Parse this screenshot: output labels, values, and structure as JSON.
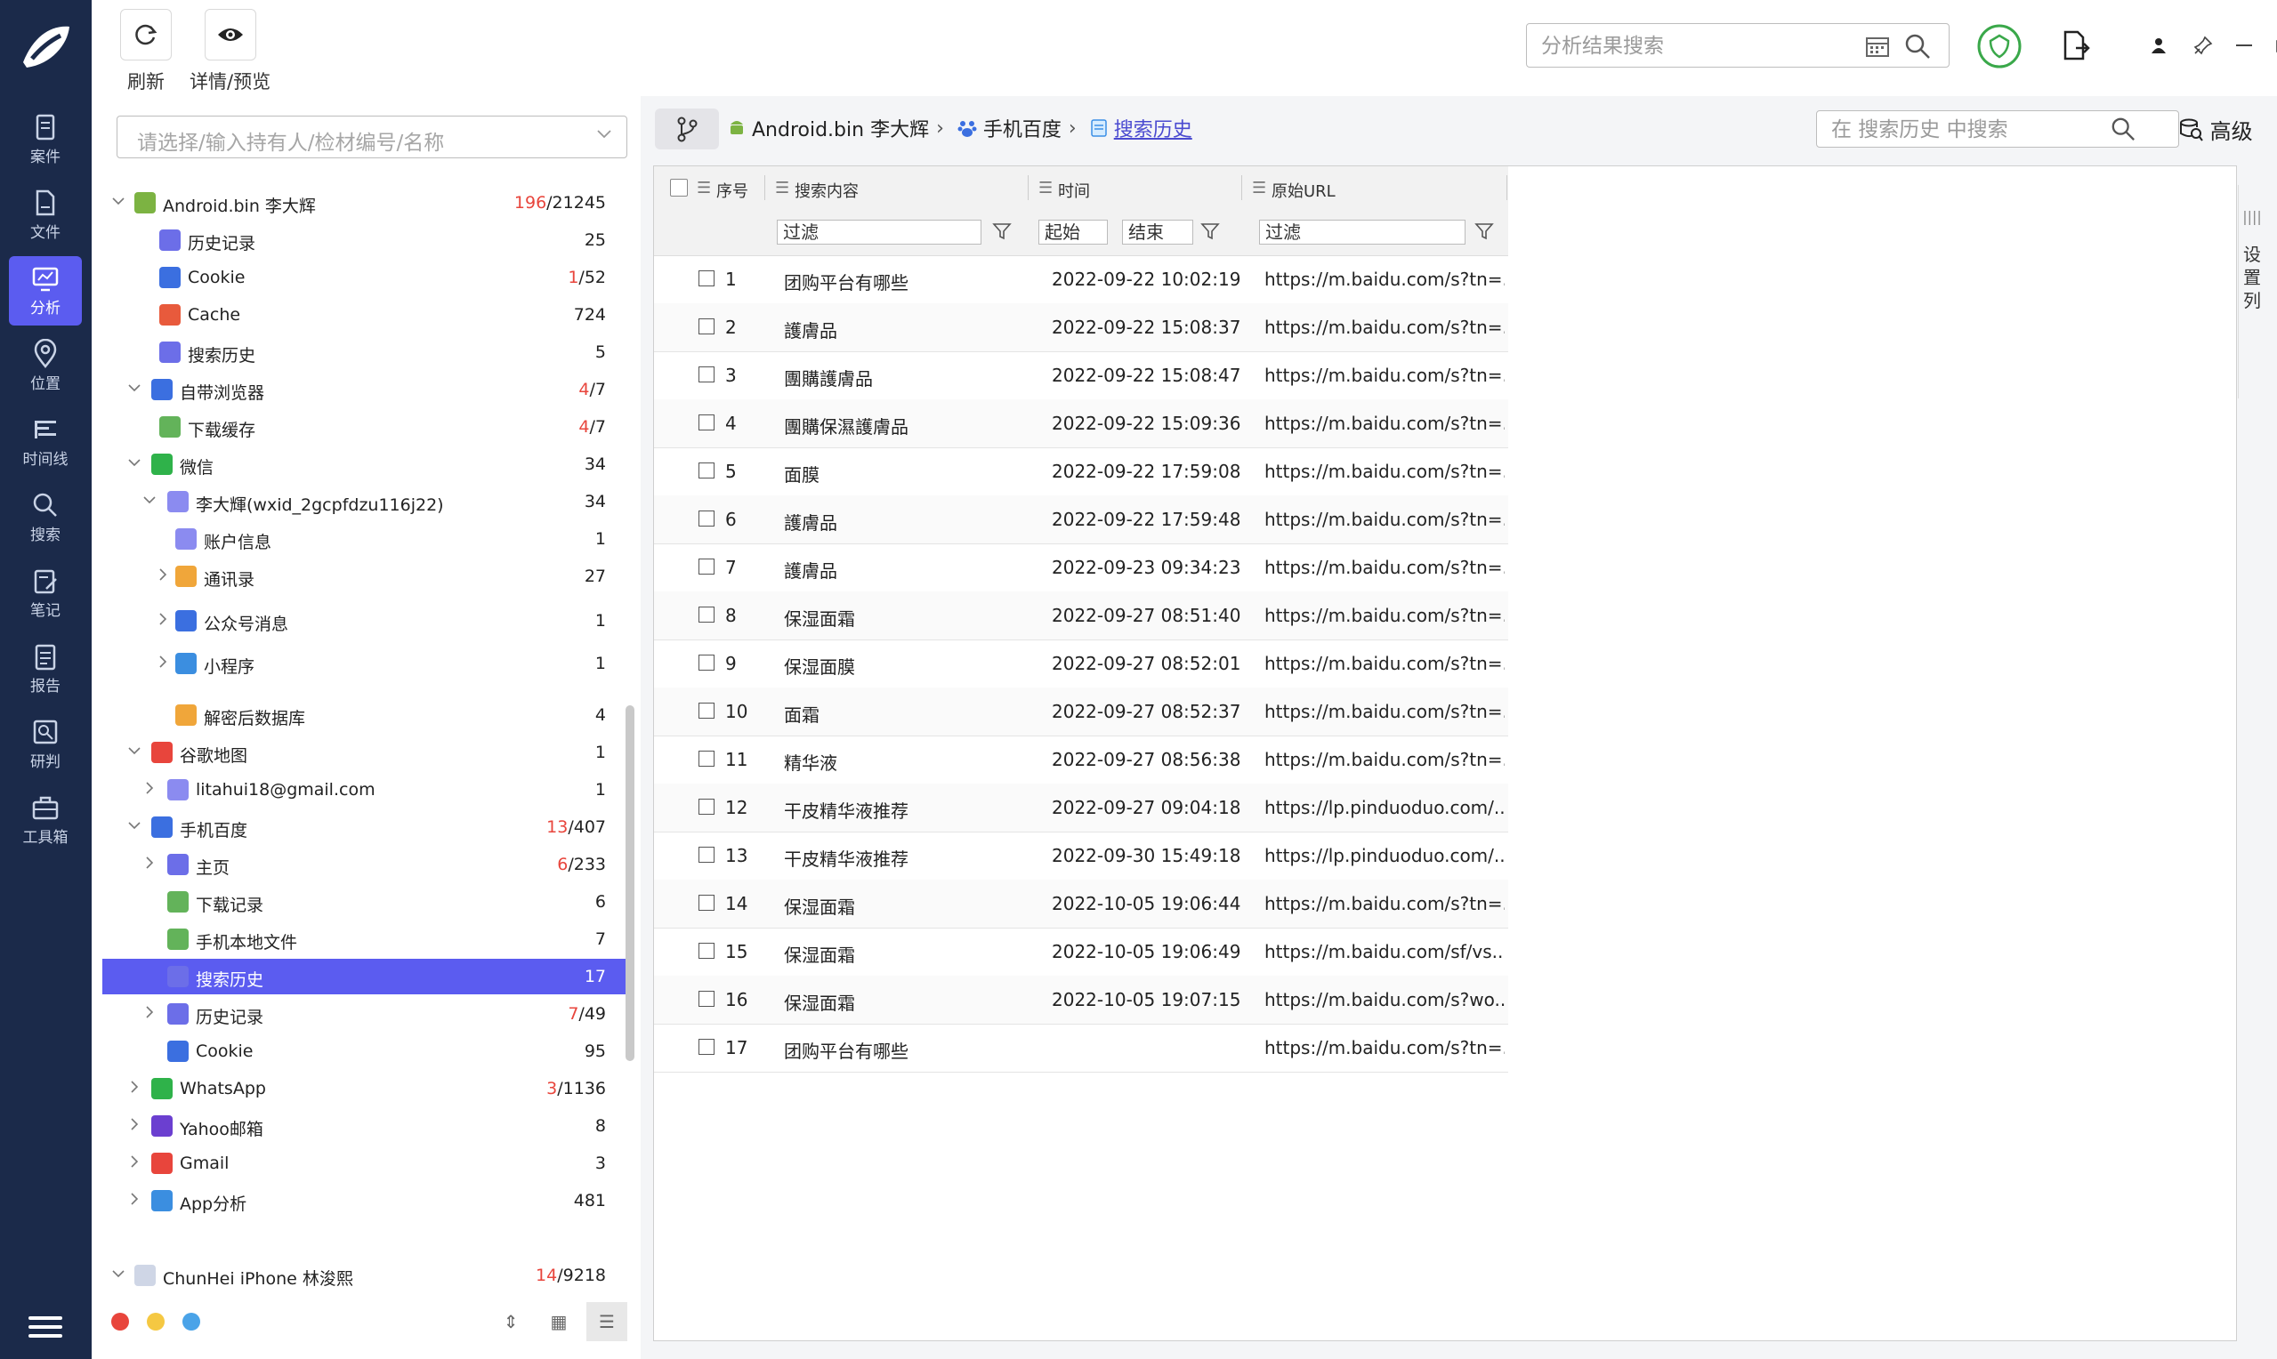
{
  "rail": {
    "items": [
      {
        "label": "案件",
        "icon": "case-icon"
      },
      {
        "label": "文件",
        "icon": "file-icon"
      },
      {
        "label": "分析",
        "icon": "analysis-icon"
      },
      {
        "label": "位置",
        "icon": "location-icon"
      },
      {
        "label": "时间线",
        "icon": "timeline-icon"
      },
      {
        "label": "搜索",
        "icon": "search-icon"
      },
      {
        "label": "笔记",
        "icon": "note-icon"
      },
      {
        "label": "报告",
        "icon": "report-icon"
      },
      {
        "label": "研判",
        "icon": "judge-icon"
      },
      {
        "label": "工具箱",
        "icon": "toolbox-icon"
      }
    ],
    "active_index": 2,
    "accent": "#5b5cf0",
    "bg": "#1b2a4a"
  },
  "toolbar": {
    "refresh_label": "刷新",
    "preview_label": "详情/预览",
    "search_placeholder": "分析结果搜索"
  },
  "tree": {
    "filter_placeholder": "请选择/输入持有人/检材编号/名称",
    "rows": [
      {
        "label": "Android.bin 李大辉",
        "count_red": "196",
        "count": "/21245",
        "icon": "android-icon"
      },
      {
        "label": "历史记录",
        "count_red": "",
        "count": "25",
        "icon": "history-icon"
      },
      {
        "label": "Cookie",
        "count_red": "1",
        "count": "/52",
        "icon": "cookie-icon"
      },
      {
        "label": "Cache",
        "count_red": "",
        "count": "724",
        "icon": "cache-icon"
      },
      {
        "label": "搜索历史",
        "count_red": "",
        "count": "5",
        "icon": "search-history-icon"
      },
      {
        "label": "自带浏览器",
        "count_red": "4",
        "count": "/7",
        "icon": "browser-icon"
      },
      {
        "label": "下载缓存",
        "count_red": "4",
        "count": "/7",
        "icon": "download-icon"
      },
      {
        "label": "微信",
        "count_red": "",
        "count": "34",
        "icon": "wechat-icon"
      },
      {
        "label": "李大輝(wxid_2gcpfdzu116j22)",
        "count_red": "",
        "count": "34",
        "icon": "user-icon"
      },
      {
        "label": "账户信息",
        "count_red": "",
        "count": "1",
        "icon": "account-icon"
      },
      {
        "label": "通讯录",
        "count_red": "",
        "count": "27",
        "icon": "contacts-icon"
      },
      {
        "label": "公众号消息",
        "count_red": "",
        "count": "1",
        "icon": "official-account-icon"
      },
      {
        "label": "小程序",
        "count_red": "",
        "count": "1",
        "icon": "mini-program-icon"
      },
      {
        "label": "解密后数据库",
        "count_red": "",
        "count": "4",
        "icon": "database-icon"
      },
      {
        "label": "谷歌地图",
        "count_red": "",
        "count": "1",
        "icon": "google-maps-icon"
      },
      {
        "label": "litahui18@gmail.com",
        "count_red": "",
        "count": "1",
        "icon": "user-icon"
      },
      {
        "label": "手机百度",
        "count_red": "13",
        "count": "/407",
        "icon": "baidu-icon"
      },
      {
        "label": "主页",
        "count_red": "6",
        "count": "/233",
        "icon": "home-icon"
      },
      {
        "label": "下载记录",
        "count_red": "",
        "count": "6",
        "icon": "download-record-icon"
      },
      {
        "label": "手机本地文件",
        "count_red": "",
        "count": "7",
        "icon": "local-file-icon"
      },
      {
        "label": "搜索历史",
        "count_red": "",
        "count": "17",
        "icon": "search-history-icon"
      },
      {
        "label": "历史记录",
        "count_red": "7",
        "count": "/49",
        "icon": "history-icon"
      },
      {
        "label": "Cookie",
        "count_red": "",
        "count": "95",
        "icon": "cookie-icon"
      },
      {
        "label": "WhatsApp",
        "count_red": "3",
        "count": "/1136",
        "icon": "whatsapp-icon"
      },
      {
        "label": "Yahoo邮箱",
        "count_red": "",
        "count": "8",
        "icon": "yahoo-mail-icon"
      },
      {
        "label": "Gmail",
        "count_red": "",
        "count": "3",
        "icon": "gmail-icon"
      },
      {
        "label": "App分析",
        "count_red": "",
        "count": "481",
        "icon": "app-analysis-icon"
      },
      {
        "label": "ChunHei iPhone 林浚熙",
        "count_red": "14",
        "count": "/9218",
        "icon": "apple-icon"
      }
    ]
  },
  "breadcrumb": {
    "items": [
      "Android.bin 李大辉",
      "手机百度",
      "搜索历史"
    ],
    "search_placeholder": "在 搜索历史 中搜索",
    "advanced_label": "高级"
  },
  "grid": {
    "columns": [
      "序号",
      "搜索内容",
      "时间",
      "原始URL"
    ],
    "filters": {
      "text": "过滤",
      "start": "起始",
      "end": "结束"
    },
    "rows": [
      {
        "no": "1",
        "query": "团购平台有哪些",
        "time": "2022-09-22 10:02:19",
        "url": "https://m.baidu.com/s?tn=..."
      },
      {
        "no": "2",
        "query": "護膚品",
        "time": "2022-09-22 15:08:37",
        "url": "https://m.baidu.com/s?tn=..."
      },
      {
        "no": "3",
        "query": "團購護膚品",
        "time": "2022-09-22 15:08:47",
        "url": "https://m.baidu.com/s?tn=..."
      },
      {
        "no": "4",
        "query": "團購保濕護膚品",
        "time": "2022-09-22 15:09:36",
        "url": "https://m.baidu.com/s?tn=..."
      },
      {
        "no": "5",
        "query": "面膜",
        "time": "2022-09-22 17:59:08",
        "url": "https://m.baidu.com/s?tn=..."
      },
      {
        "no": "6",
        "query": "護膚品",
        "time": "2022-09-22 17:59:48",
        "url": "https://m.baidu.com/s?tn=..."
      },
      {
        "no": "7",
        "query": "護膚品",
        "time": "2022-09-23 09:34:23",
        "url": "https://m.baidu.com/s?tn=..."
      },
      {
        "no": "8",
        "query": "保湿面霜",
        "time": "2022-09-27 08:51:40",
        "url": "https://m.baidu.com/s?tn=..."
      },
      {
        "no": "9",
        "query": "保湿面膜",
        "time": "2022-09-27 08:52:01",
        "url": "https://m.baidu.com/s?tn=..."
      },
      {
        "no": "10",
        "query": "面霜",
        "time": "2022-09-27 08:52:37",
        "url": "https://m.baidu.com/s?tn=..."
      },
      {
        "no": "11",
        "query": "精华液",
        "time": "2022-09-27 08:56:38",
        "url": "https://m.baidu.com/s?tn=..."
      },
      {
        "no": "12",
        "query": "干皮精华液推荐",
        "time": "2022-09-27 09:04:18",
        "url": "https://lp.pinduoduo.com/..."
      },
      {
        "no": "13",
        "query": "干皮精华液推荐",
        "time": "2022-09-30 15:49:18",
        "url": "https://lp.pinduoduo.com/..."
      },
      {
        "no": "14",
        "query": "保湿面霜",
        "time": "2022-10-05 19:06:44",
        "url": "https://m.baidu.com/s?tn=..."
      },
      {
        "no": "15",
        "query": "保湿面霜",
        "time": "2022-10-05 19:06:49",
        "url": "https://m.baidu.com/sf/vs..."
      },
      {
        "no": "16",
        "query": "保湿面霜",
        "time": "2022-10-05 19:07:15",
        "url": "https://m.baidu.com/s?wo..."
      },
      {
        "no": "17",
        "query": "团购平台有哪些",
        "time": "",
        "url": "https://m.baidu.com/s?tn=..."
      }
    ]
  },
  "column_settings_label": "设置列",
  "colors": {
    "red": "#e8453c",
    "selection": "#5b5cf0",
    "link": "#4a4ad0"
  }
}
